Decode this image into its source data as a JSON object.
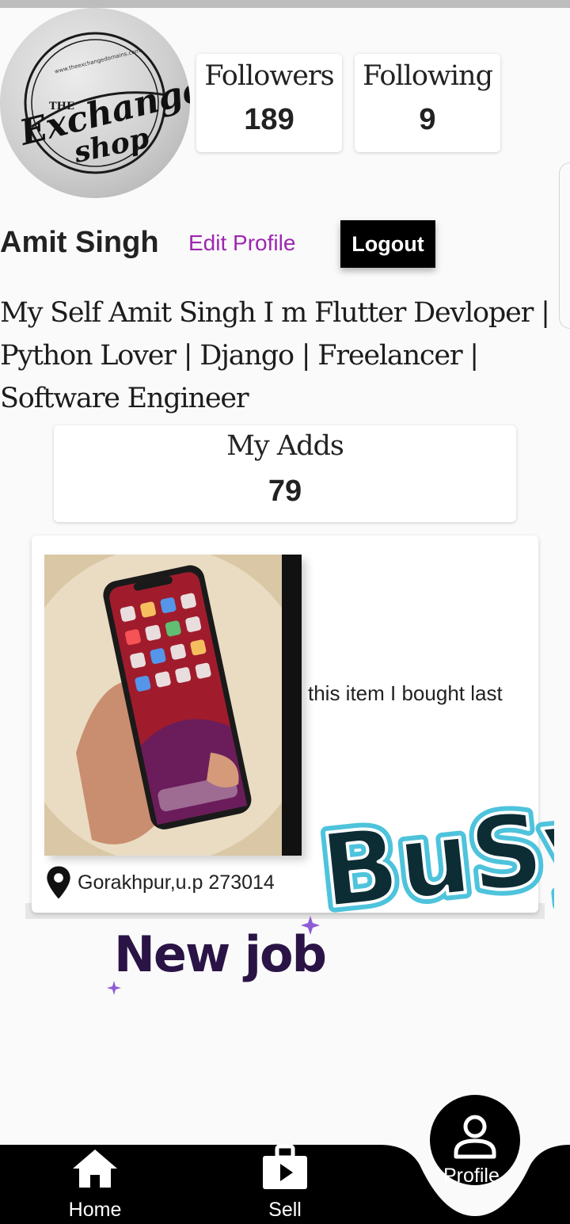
{
  "profile": {
    "logo_text": {
      "top": "THE",
      "main": "Exchange",
      "sub": "shop",
      "url": "www.theexchangedomains.com"
    },
    "name": "Amit Singh",
    "edit_label": "Edit Profile",
    "logout_label": "Logout",
    "bio": "My Self Amit Singh I m Flutter Devloper | Python Lover | Django | Freelancer | Software Engineer"
  },
  "stats": {
    "followers_label": "Followers",
    "followers_value": "189",
    "following_label": "Following",
    "following_value": "9",
    "adds_label": "My Adds",
    "adds_value": "79"
  },
  "item": {
    "description": "this item I bought last",
    "location": "Gorakhpur,u.p 273014"
  },
  "stickers": {
    "busy": "BuSy",
    "new_job": "New job"
  },
  "nav": {
    "home_label": "Home",
    "sell_label": "Sell",
    "profile_label": "Profile"
  },
  "colors": {
    "accent": "#9c27b0",
    "nav_bg": "#000000",
    "page_bg": "#fafafa",
    "busy_fill": "#0d2d35",
    "busy_outline": "#4ec3dc",
    "newjob_text": "#2a1446"
  }
}
